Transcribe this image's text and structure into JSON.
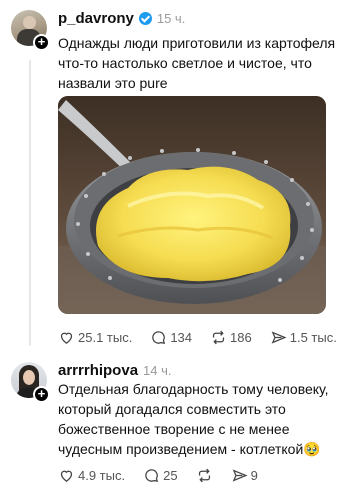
{
  "posts": [
    {
      "username": "p_davrony",
      "verified": true,
      "time": "15 ч.",
      "text": "Однажды люди приготовили из картофеля что-то настолько светлое и чистое, что назвали это pure",
      "image_icon": "mashed-potatoes-photo",
      "stats": {
        "likes": "25.1 тыс.",
        "comments": "134",
        "reposts": "186",
        "shares": "1.5 тыс."
      }
    },
    {
      "username": "arrrrhipova",
      "verified": false,
      "time": "14 ч.",
      "text": "Отдельная благодарность тому человеку, который догадался совместить это божественное творение с не менее чудесным произведением - котлеткой🥹",
      "stats": {
        "likes": "4.9 тыс.",
        "comments": "25",
        "reposts": "",
        "shares": "9"
      }
    }
  ],
  "icons": {
    "like": "heart-icon",
    "comment": "comment-icon",
    "repost": "repost-icon",
    "share": "share-icon",
    "follow": "plus-icon"
  },
  "colors": {
    "verified": "#1d9bf0",
    "text": "#101010",
    "muted": "#9a9a9a"
  }
}
